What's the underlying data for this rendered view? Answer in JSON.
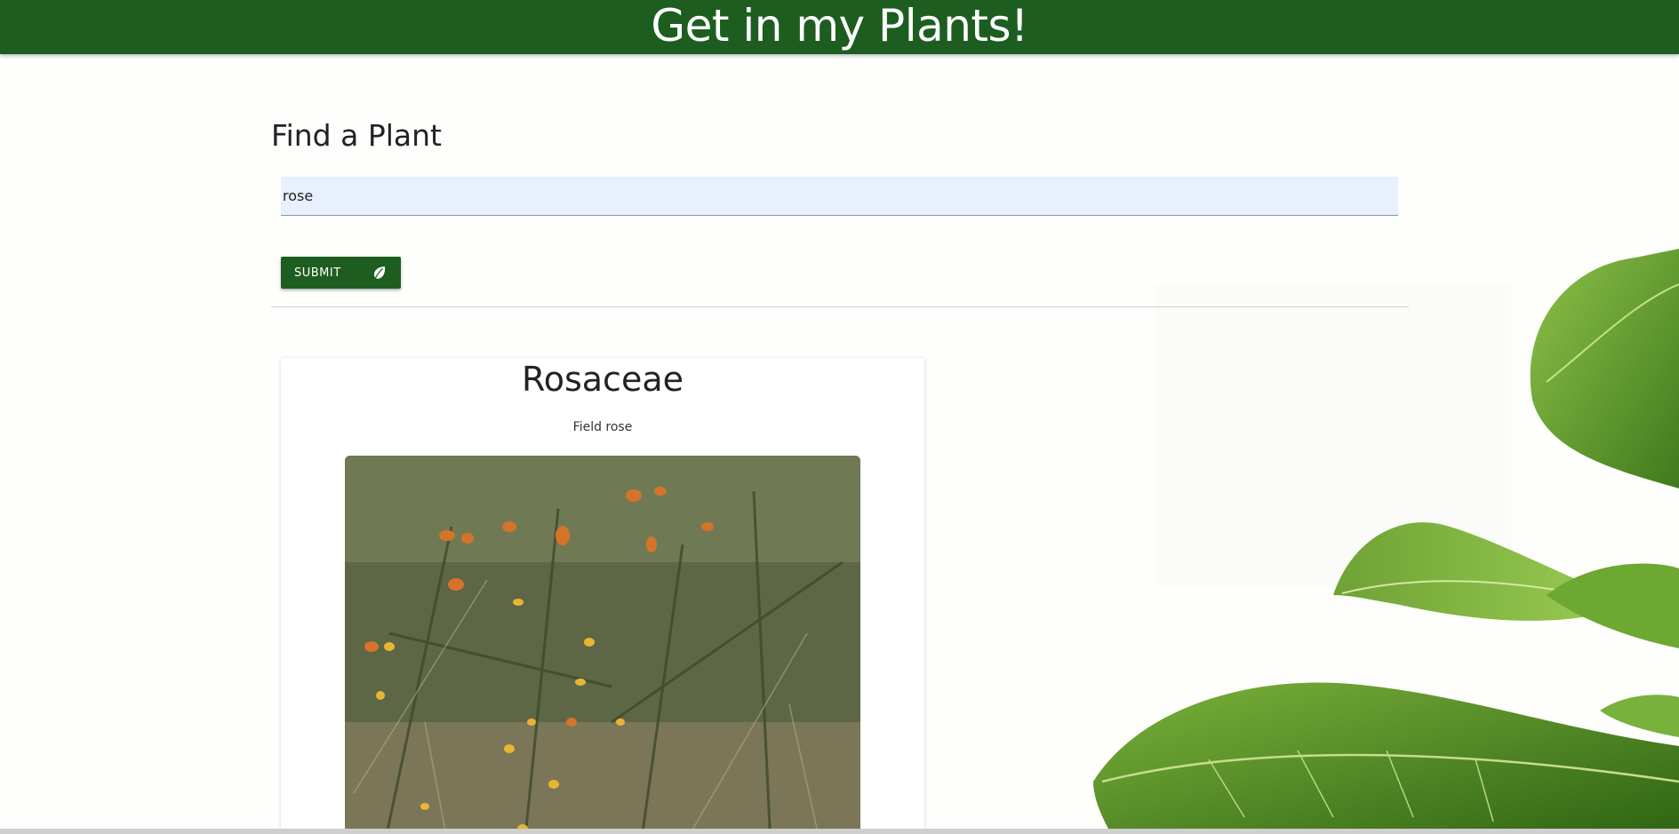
{
  "header": {
    "title": "Get in my Plants!",
    "background_color": "#1d5e20"
  },
  "search": {
    "section_title": "Find a Plant",
    "value": "rose",
    "submit_label": "SUBMIT",
    "submit_icon": "leaf-icon"
  },
  "results": [
    {
      "family": "Rosaceae",
      "common_name": "Field rose",
      "image": "rose-hip-shrub-photo"
    }
  ],
  "decoration": {
    "background_image": "green-leaves-illustration"
  }
}
